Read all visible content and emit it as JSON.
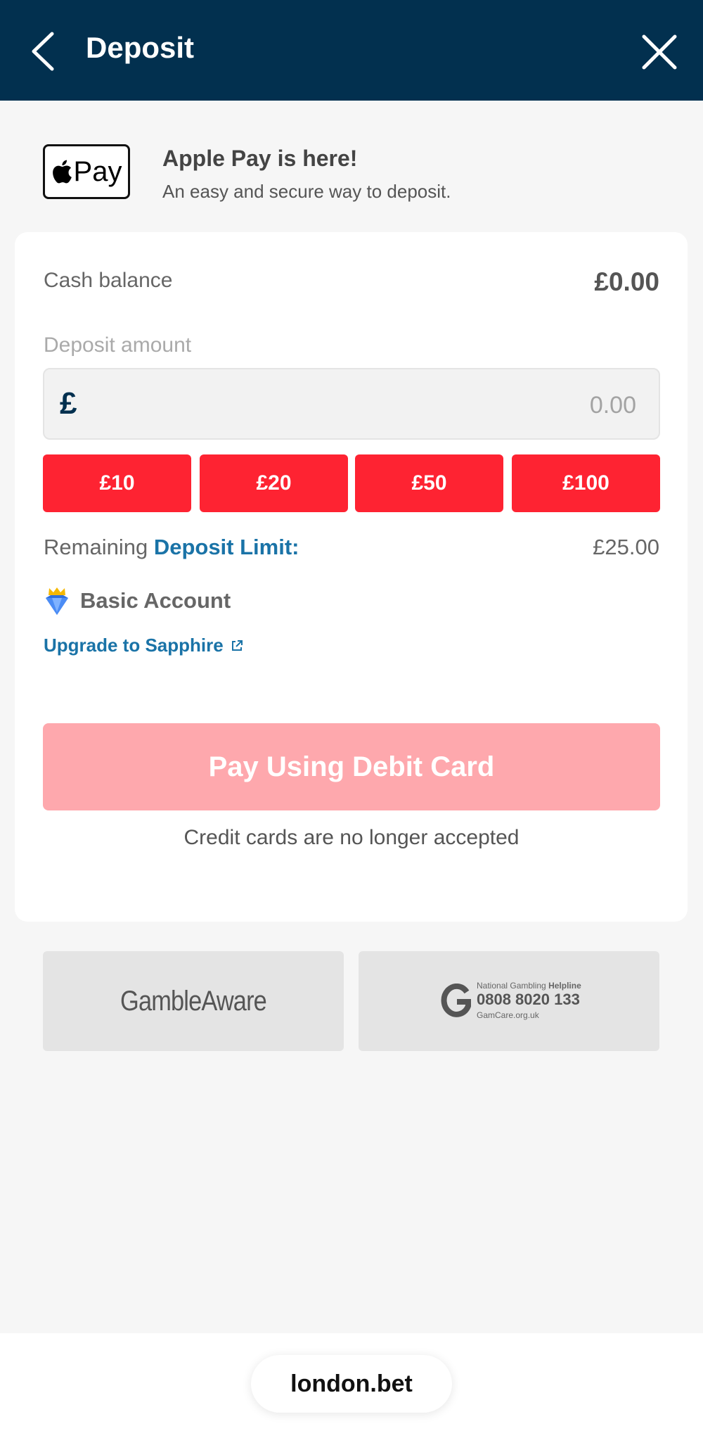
{
  "header": {
    "title": "Deposit",
    "back_icon": "chevron-left-icon",
    "close_icon": "close-icon"
  },
  "apple_pay": {
    "logo_text": "Pay",
    "title": "Apple Pay is here!",
    "subtitle": "An easy and secure way to deposit."
  },
  "balance": {
    "label": "Cash balance",
    "value": "£0.00"
  },
  "deposit": {
    "label": "Deposit amount",
    "currency_symbol": "£",
    "placeholder": "0.00",
    "quick_amounts": [
      "£10",
      "£20",
      "£50",
      "£100"
    ]
  },
  "limit": {
    "prefix": "Remaining ",
    "link": "Deposit Limit:",
    "value": "£25.00"
  },
  "account": {
    "tier": "Basic Account",
    "upgrade_link": "Upgrade to Sapphire"
  },
  "pay_button": {
    "label": "Pay Using Debit Card"
  },
  "credit_note": "Credit cards are no longer accepted",
  "responsible": {
    "gambleaware": "GambleAware",
    "gamcare_small": "National Gambling",
    "gamcare_small_bold": "Helpline",
    "gamcare_phone": "0808 8020 133",
    "gamcare_site": "GamCare.org.uk"
  },
  "footer": {
    "brand": "london.bet"
  },
  "colors": {
    "header_bg": "#02304f",
    "accent_red": "#fe2332",
    "pay_disabled": "#fea8ad",
    "link_blue": "#1a73a7"
  }
}
